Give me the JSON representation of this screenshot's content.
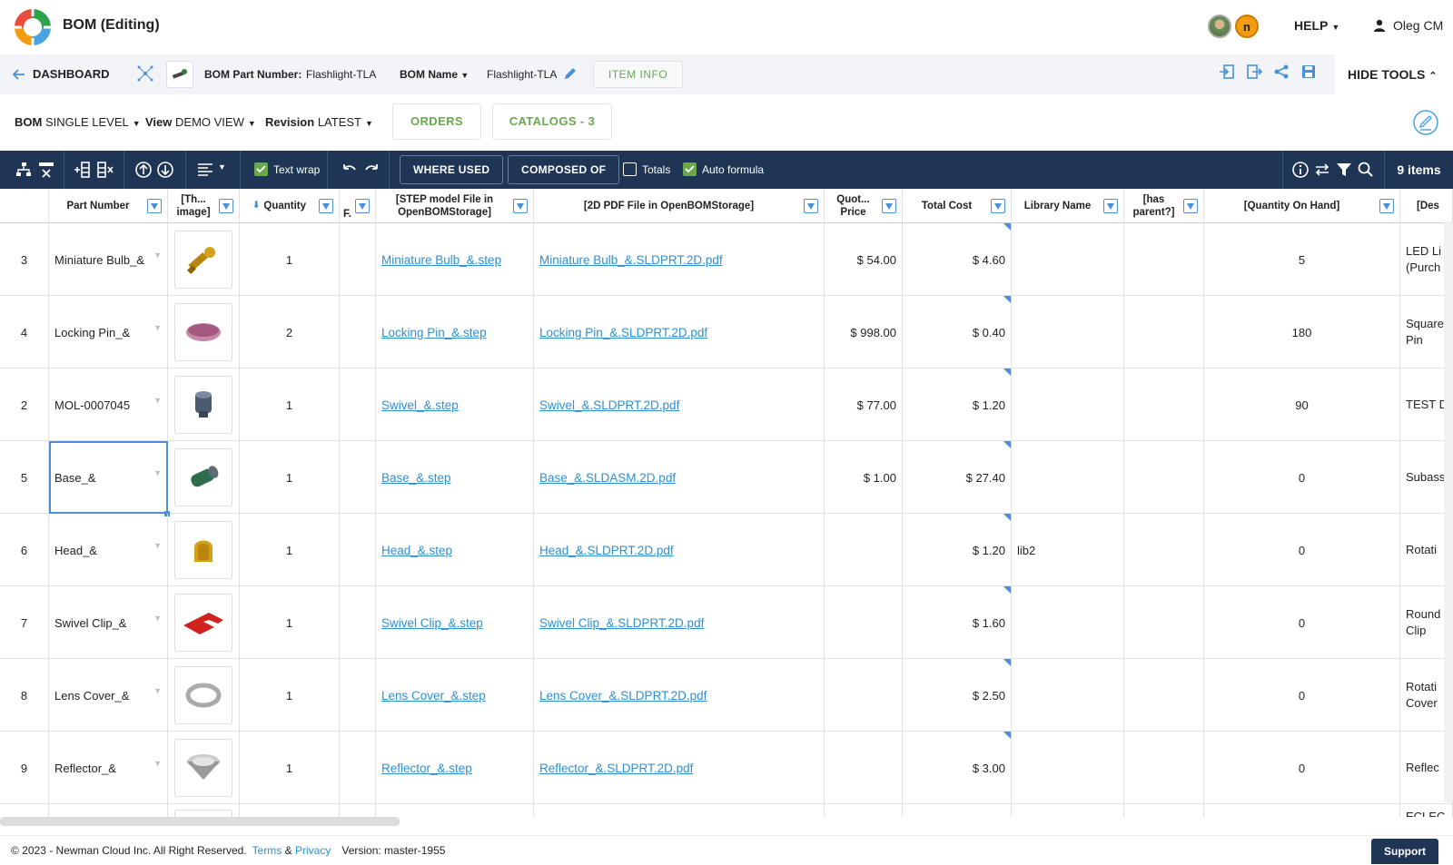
{
  "header": {
    "app_title": "BOM (Editing)",
    "help_label": "HELP",
    "user_name": "Oleg CM"
  },
  "nav": {
    "dashboard_label": "DASHBOARD",
    "bom_part_number_label": "BOM Part Number:",
    "bom_part_number_value": "Flashlight-TLA",
    "bom_name_label": "BOM Name",
    "bom_name_value": "Flashlight-TLA",
    "item_info_label": "ITEM INFO",
    "hide_tools_label": "HIDE TOOLS"
  },
  "view_bar": {
    "bom_label": "BOM",
    "bom_value": "SINGLE LEVEL",
    "view_label": "View",
    "view_value": "DEMO VIEW",
    "revision_label": "Revision",
    "revision_value": "LATEST",
    "orders_label": "ORDERS",
    "catalogs_label": "CATALOGS - 3"
  },
  "toolbar": {
    "text_wrap_label": "Text wrap",
    "text_wrap_checked": true,
    "where_used_label": "WHERE USED",
    "composed_of_label": "COMPOSED OF",
    "totals_label": "Totals",
    "totals_checked": false,
    "auto_formula_label": "Auto formula",
    "auto_formula_checked": true,
    "items_count": "9 items"
  },
  "columns": {
    "part_number": "Part Number",
    "thumbnail": "[Th... image]",
    "quantity": "Quantity",
    "f": "F.",
    "step_file": "[STEP model File in OpenBOMStorage]",
    "pdf_file": "[2D PDF File in OpenBOMStorage]",
    "quote_price": "Quot... Price",
    "total_cost": "Total Cost",
    "library_name": "Library Name",
    "has_parent": "[has parent?]",
    "qty_on_hand": "[Quantity On Hand]",
    "description": "[Des"
  },
  "rows": [
    {
      "num": "3",
      "part": "Miniature Bulb_&",
      "qty": "1",
      "step": "Miniature Bulb_&.step",
      "pdf": "Miniature Bulb_&.SLDPRT.2D.pdf",
      "price": "$ 54.00",
      "cost": "$ 4.60",
      "lib": "",
      "onhand": "5",
      "desc": "LED Li (Purch"
    },
    {
      "num": "4",
      "part": "Locking Pin_&",
      "qty": "2",
      "step": "Locking Pin_&.step",
      "pdf": "Locking Pin_&.SLDPRT.2D.pdf",
      "price": "$ 998.00",
      "cost": "$ 0.40",
      "lib": "",
      "onhand": "180",
      "desc": "Square Pin"
    },
    {
      "num": "2",
      "part": "MOL-0007045",
      "qty": "1",
      "step": "Swivel_&.step",
      "pdf": "Swivel_&.SLDPRT.2D.pdf",
      "price": "$ 77.00",
      "cost": "$ 1.20",
      "lib": "",
      "onhand": "90",
      "desc": "TEST D"
    },
    {
      "num": "5",
      "part": "Base_&",
      "qty": "1",
      "step": "Base_&.step",
      "pdf": "Base_&.SLDASM.2D.pdf",
      "price": "$ 1.00",
      "cost": "$ 27.40",
      "lib": "",
      "onhand": "0",
      "desc": "Subass"
    },
    {
      "num": "6",
      "part": "Head_&",
      "qty": "1",
      "step": "Head_&.step",
      "pdf": "Head_&.SLDPRT.2D.pdf",
      "price": "",
      "cost": "$ 1.20",
      "lib": "lib2",
      "onhand": "0",
      "desc": "Rotati"
    },
    {
      "num": "7",
      "part": "Swivel Clip_&",
      "qty": "1",
      "step": "Swivel Clip_&.step",
      "pdf": "Swivel Clip_&.SLDPRT.2D.pdf",
      "price": "",
      "cost": "$ 1.60",
      "lib": "",
      "onhand": "0",
      "desc": "Round Clip"
    },
    {
      "num": "8",
      "part": "Lens Cover_&",
      "qty": "1",
      "step": "Lens Cover_&.step",
      "pdf": "Lens Cover_&.SLDPRT.2D.pdf",
      "price": "",
      "cost": "$ 2.50",
      "lib": "",
      "onhand": "0",
      "desc": "Rotati Cover"
    },
    {
      "num": "9",
      "part": "Reflector_&",
      "qty": "1",
      "step": "Reflector_&.step",
      "pdf": "Reflector_&.SLDPRT.2D.pdf",
      "price": "",
      "cost": "$ 3.00",
      "lib": "",
      "onhand": "0",
      "desc": "Reflec"
    }
  ],
  "partial_row_desc": "ECLEC",
  "footer": {
    "copyright": "© 2023 - Newman Cloud Inc. All Right Reserved.",
    "terms": "Terms",
    "amp": "&",
    "privacy": "Privacy",
    "version": "Version: master-1955",
    "support_label": "Support"
  },
  "colors": {
    "navy": "#1e3556",
    "accent_green": "#6aa84f",
    "link_blue": "#2f8fd0"
  }
}
